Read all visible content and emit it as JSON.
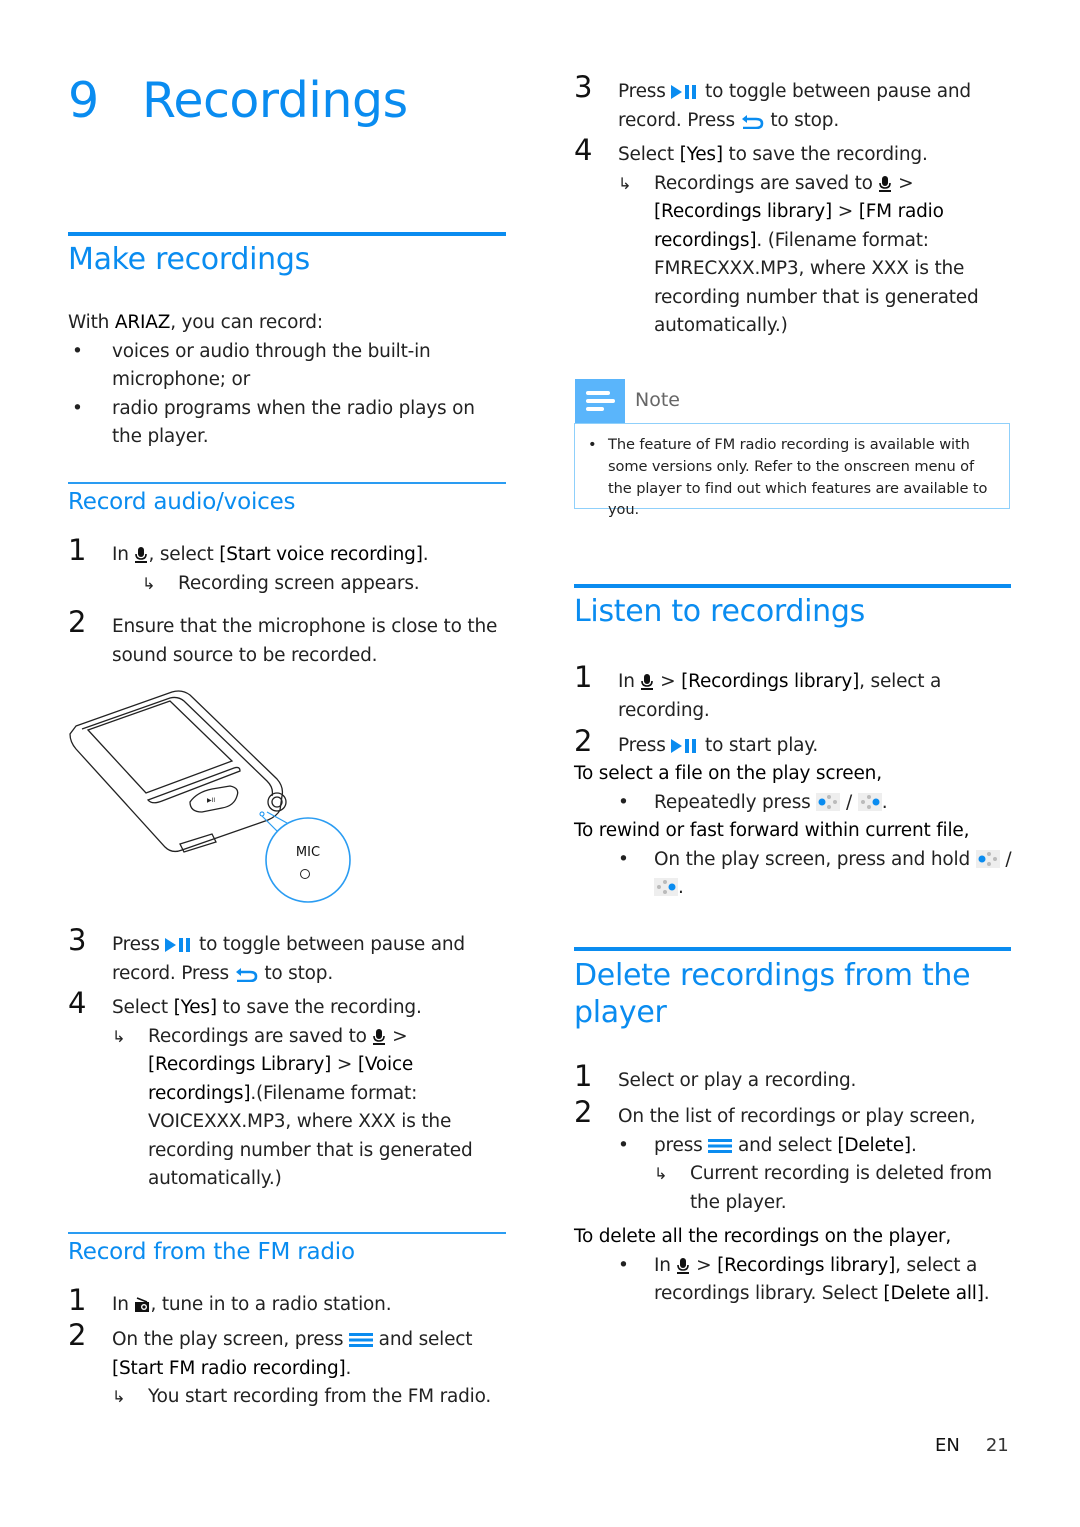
{
  "chapter": {
    "number": "9",
    "title": "Recordings"
  },
  "make_recordings": {
    "title": "Make recordings",
    "intro_prefix": "With ",
    "intro_product": "ARIAZ",
    "intro_suffix": ", you can record:",
    "bullets": [
      "voices or audio through the built-in microphone; or",
      "radio programs when the radio plays on the player."
    ]
  },
  "record_audio": {
    "title": "Record audio/voices",
    "steps": [
      {
        "n": "1",
        "a": "In ",
        "icon": "microphone-icon",
        "b": ", select ",
        "bold": "[Start voice recording]",
        "c": ".",
        "result": "Recording screen appears."
      },
      {
        "n": "2",
        "text": "Ensure that the microphone is close to the sound source to be recorded."
      },
      {
        "n": "3",
        "a": "Press ",
        "icon": "play-pause-icon",
        "b": " to toggle between pause and record. Press ",
        "icon2": "back-icon",
        "c": " to stop."
      },
      {
        "n": "4",
        "a": "Select ",
        "bold": "[Yes]",
        "b": " to save the recording.",
        "result_a": "Recordings are saved to ",
        "result_icon": "microphone-icon",
        "result_b": " > ",
        "result_bold1": "[Recordings Library]",
        "result_c": " > ",
        "result_bold2": "[Voice recordings]",
        "result_d": ".(Filename format: VOICEXXX.MP3, where XXX is the recording number that is generated automatically.)"
      }
    ],
    "figure": {
      "callout_label": "MIC"
    }
  },
  "record_fm": {
    "title": "Record from the FM radio",
    "steps": [
      {
        "n": "1",
        "a": "In ",
        "icon": "radio-icon",
        "b": ", tune in to a radio station."
      },
      {
        "n": "2",
        "a": "On the play screen, press ",
        "icon": "menu-icon",
        "b": " and select ",
        "bold": "[Start FM radio recording]",
        "c": ".",
        "result": "You start recording from the FM radio."
      },
      {
        "n": "3",
        "a": "Press ",
        "icon": "play-pause-icon",
        "b": " to toggle between pause and record. Press ",
        "icon2": "back-icon",
        "c": " to stop."
      },
      {
        "n": "4",
        "a": "Select ",
        "bold": "[Yes]",
        "b": " to save the recording.",
        "result_a": "Recordings are saved to ",
        "result_icon": "microphone-icon",
        "result_b": " > ",
        "result_bold1": "[Recordings library]",
        "result_c": " > ",
        "result_bold2": "[FM radio recordings]",
        "result_d": ". (Filename format: FMRECXXX.MP3, where XXX is the recording number that is generated automatically.)"
      }
    ]
  },
  "note": {
    "label": "Note",
    "text": "The feature of FM radio recording is available with some versions only. Refer to the onscreen menu of the player to find out which features are available to you."
  },
  "listen": {
    "title": "Listen to recordings",
    "step1": {
      "n": "1",
      "a": "In ",
      "b": " > ",
      "bold": "[Recordings library]",
      "c": ", select a recording."
    },
    "step2": {
      "n": "2",
      "a": "Press ",
      "b": " to start play."
    },
    "select_heading": "To select a file on the play screen,",
    "select_bullet_a": "Repeatedly press ",
    "select_bullet_sep": " / ",
    "select_bullet_end": ".",
    "rewind_heading": "To rewind or fast forward within current file,",
    "rewind_bullet_a": "On the play screen, press and hold ",
    "rewind_bullet_sep": " / ",
    "rewind_bullet_end": "."
  },
  "delete": {
    "title": "Delete recordings from the player",
    "step1": {
      "n": "1",
      "text": "Select or play a recording."
    },
    "step2": {
      "n": "2",
      "text": "On the list of recordings or play screen,"
    },
    "bullet_a": "press ",
    "bullet_b": " and select ",
    "bullet_bold": "[Delete]",
    "bullet_c": ".",
    "result": "Current recording is deleted from the player.",
    "all_heading": "To delete all the recordings on the player,",
    "all_a": "In ",
    "all_b": " > ",
    "all_bold1": "[Recordings library]",
    "all_c": ", select a recordings library. Select ",
    "all_bold2": "[Delete all]",
    "all_d": "."
  },
  "footer": {
    "lang": "EN",
    "page": "21"
  },
  "colors": {
    "accent": "#0a8cf0",
    "note_tab": "#5ab5fb",
    "note_border": "#8fd0fb"
  }
}
